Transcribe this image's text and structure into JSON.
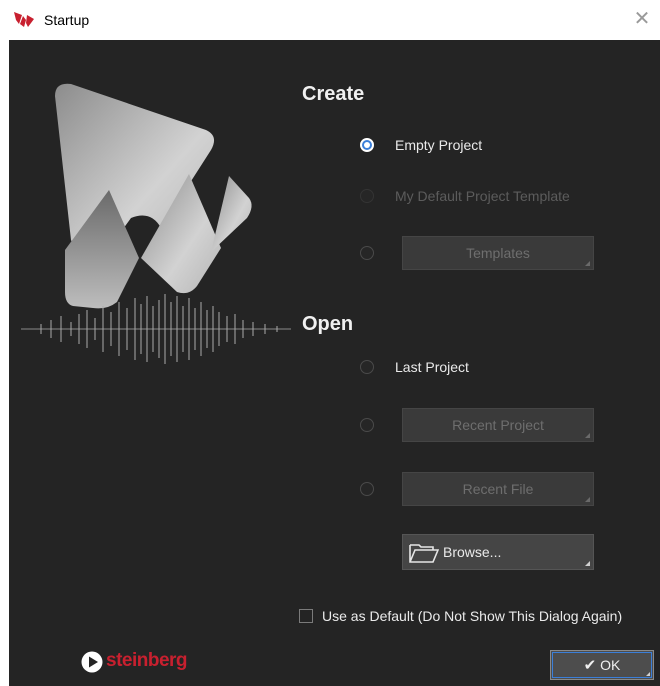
{
  "window": {
    "title": "Startup",
    "close_glyph": "✕",
    "app_icon": "wavelab-icon"
  },
  "create": {
    "heading": "Create",
    "options": [
      {
        "label": "Empty Project",
        "selected": true,
        "enabled": true
      },
      {
        "label": "My Default Project Template",
        "selected": false,
        "enabled": false
      },
      {
        "label": "Templates",
        "selected": false,
        "enabled": true,
        "is_button": true
      }
    ]
  },
  "open": {
    "heading": "Open",
    "options": [
      {
        "label": "Last Project",
        "selected": false,
        "enabled": true
      },
      {
        "label": "Recent Project",
        "selected": false,
        "enabled": true,
        "is_button": true
      },
      {
        "label": "Recent File",
        "selected": false,
        "enabled": true,
        "is_button": true
      }
    ],
    "browse_label": "Browse..."
  },
  "footer": {
    "default_checkbox_label": "Use as Default (Do Not Show This Dialog Again)",
    "default_checked": false,
    "brand": "steinberg",
    "ok_label": "OK"
  },
  "colors": {
    "background": "#242424",
    "accent": "#3b7fd9",
    "brand_red": "#c8202f",
    "disabled_text": "#5c5c5c"
  }
}
